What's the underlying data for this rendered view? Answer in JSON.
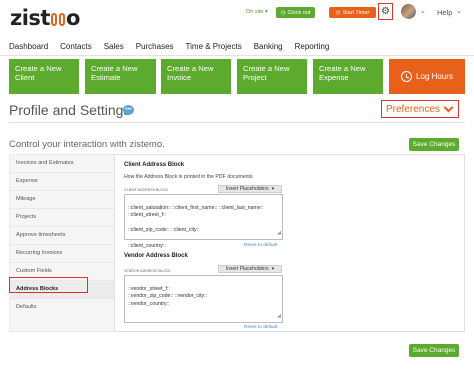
{
  "header": {
    "logo": "zistemo",
    "onsite": "On site",
    "clock_out": "Clock out",
    "start_timer": "Start Timer",
    "help": "Help"
  },
  "nav": [
    "Dashboard",
    "Contacts",
    "Sales",
    "Purchases",
    "Time & Projects",
    "Banking",
    "Reporting"
  ],
  "tiles": {
    "client": "Create a New Client",
    "estimate": "Create a New Estimate",
    "invoice": "Create a New Invoice",
    "project": "Create a New Project",
    "expense": "Create a New Expense",
    "log_hours": "Log Hours"
  },
  "page": {
    "title": "Profile and Settings",
    "preferences": "Preferences",
    "control_text": "Control your interaction with zistemo.",
    "save_changes": "Save Changes"
  },
  "sidebar": {
    "items": [
      "Invoices and Estimates",
      "Expense",
      "Mileage",
      "Projects",
      "Approve timesheets",
      "Recurring Invoices",
      "Custom Fields",
      "Address Blocks",
      "Defaults"
    ],
    "active": "Address Blocks"
  },
  "client_block": {
    "heading": "Client Address Block",
    "description": "How the Address Block is printed in the PDF documents",
    "label": "CLIENT ADDRESS BLOCK",
    "placeholder_button": "Insert Placeholders",
    "text": "::client_salutation:: ::client_first_name:: ::client_last_name::\n::client_street_f::\n\n::client_zip_code:: ::client_city::\n\n::client_country::",
    "reset": "Reset to default"
  },
  "vendor_block": {
    "heading": "Vendor Address Block",
    "label": "VENDOR ADDRESS BLOCK",
    "placeholder_button": "Insert Placeholders",
    "text": "::vendor_street_f::\n::vendor_zip_code:: ::vendor_city::\n::vendor_country::",
    "reset": "Reset to default"
  },
  "colors": {
    "green": "#5cab2e",
    "orange": "#e8611a",
    "highlight_red": "#d9332b"
  }
}
